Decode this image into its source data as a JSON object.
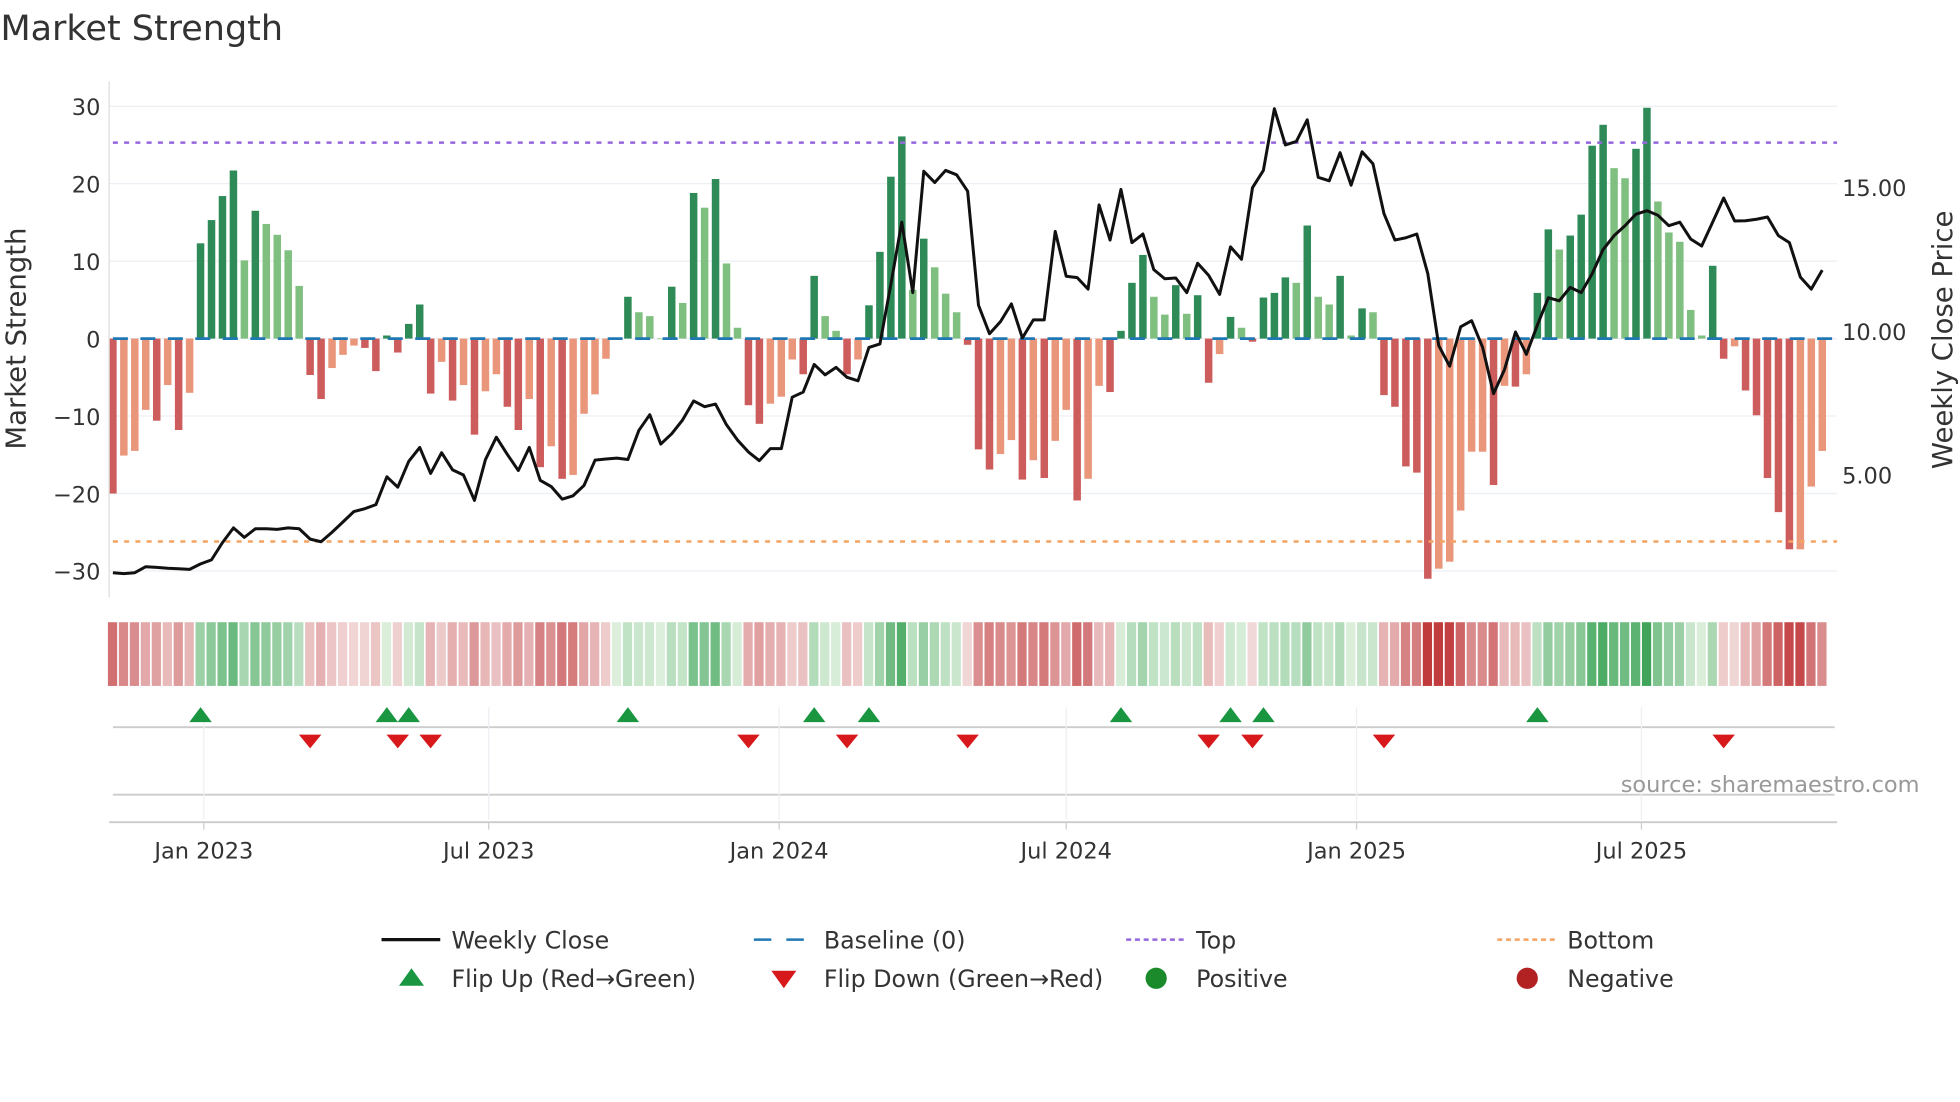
{
  "title": "Market Strength",
  "source": "source: sharemaestro.com",
  "chart_data": {
    "type": "bar+line",
    "title": "Market Strength",
    "ylabel_left": "Market Strength",
    "ylabel_right": "Weekly Close Price",
    "ylim_left": [
      -33,
      33
    ],
    "yticks_left": [
      "30",
      "20",
      "10",
      "0",
      "−10",
      "−20",
      "−30"
    ],
    "ytick_values_left": [
      30,
      20,
      10,
      0,
      -10,
      -20,
      -30
    ],
    "yticks_right": [
      "15.00",
      "10.00",
      "5.00"
    ],
    "ytick_values_right": [
      15,
      10,
      5
    ],
    "xticks": [
      "Jan 2023",
      "Jul 2023",
      "Jan 2024",
      "Jul 2024",
      "Jan 2025",
      "Jul 2025"
    ],
    "xtick_week_index": [
      8.3,
      34.3,
      60.8,
      87,
      113.5,
      139.5
    ],
    "top_level": 25.3,
    "bottom_level": -26.2,
    "baseline": 0,
    "strength": [
      -20,
      -15.1,
      -14.5,
      -9.2,
      -10.6,
      -6,
      -11.8,
      -7,
      12.3,
      15.3,
      18.4,
      21.7,
      10.1,
      16.5,
      14.8,
      13.4,
      11.4,
      6.8,
      -4.7,
      -7.8,
      -3.8,
      -2.1,
      -0.9,
      -1.2,
      -4.2,
      0.4,
      -1.8,
      1.9,
      4.4,
      -7.1,
      -3,
      -8,
      -6,
      -12.4,
      -6.8,
      -4.6,
      -8.8,
      -11.8,
      -7.8,
      -16.6,
      -13.9,
      -18.1,
      -17.6,
      -9.7,
      -7.2,
      -2.6,
      0,
      5.4,
      3.4,
      2.9,
      0,
      6.7,
      4.6,
      18.8,
      16.9,
      20.6,
      9.7,
      1.4,
      -8.6,
      -11,
      -8.4,
      -7.5,
      -2.7,
      -4.6,
      8.1,
      2.9,
      1,
      -4.6,
      -2.7,
      4.3,
      11.2,
      20.9,
      26.1,
      6.3,
      12.9,
      9.2,
      5.8,
      3.4,
      -0.8,
      -14.3,
      -16.9,
      -14.9,
      -13.1,
      -18.2,
      -15.7,
      -18,
      -13.2,
      -9.2,
      -20.9,
      -18.1,
      -6.1,
      -6.9,
      1,
      7.2,
      10.8,
      5.4,
      3.1,
      6.9,
      3.2,
      5.6,
      -5.7,
      -2,
      2.8,
      1.4,
      -0.4,
      5.3,
      5.9,
      7.9,
      7.2,
      14.6,
      5.4,
      4.4,
      8.1,
      0.4,
      3.9,
      3.4,
      -7.3,
      -8.8,
      -16.5,
      -17.3,
      -31,
      -29.7,
      -28.8,
      -22.2,
      -14.6,
      -14.6,
      -18.9,
      -6.1,
      -6.2,
      -4.6,
      5.9,
      14.1,
      11.5,
      13.3,
      16,
      24.9,
      27.6,
      22,
      20.7,
      24.5,
      29.8,
      17.7,
      13.7,
      12.5,
      3.7,
      0.4,
      9.4,
      -2.6,
      -1,
      -6.7,
      -9.9,
      -18,
      -22.4,
      -27.2,
      -27.2,
      -19.1,
      -14.5
    ],
    "weekly_close": [
      1.59,
      1.56,
      1.59,
      1.8,
      1.78,
      1.75,
      1.73,
      1.71,
      1.9,
      2.04,
      2.64,
      3.15,
      2.82,
      3.12,
      3.12,
      3.1,
      3.15,
      3.12,
      2.76,
      2.67,
      3,
      3.36,
      3.72,
      3.82,
      3.96,
      4.93,
      4.57,
      5.47,
      5.95,
      5.05,
      5.77,
      5.17,
      4.99,
      4.11,
      5.53,
      6.31,
      5.71,
      5.15,
      5.95,
      4.81,
      4.59,
      4.15,
      4.27,
      4.63,
      5.51,
      5.55,
      5.58,
      5.53,
      6.55,
      7.09,
      6.07,
      6.43,
      6.91,
      7.57,
      7.37,
      7.46,
      6.74,
      6.21,
      5.79,
      5.49,
      5.91,
      5.91,
      7.7,
      7.88,
      8.84,
      8.48,
      8.74,
      8.39,
      8.27,
      9.43,
      9.55,
      11.64,
      13.79,
      11.34,
      15.56,
      15.17,
      15.59,
      15.44,
      14.87,
      10.9,
      9.91,
      10.33,
      10.95,
      9.76,
      10.39,
      10.39,
      13.47,
      11.91,
      11.86,
      11.46,
      14.39,
      13.17,
      14.93,
      13.08,
      13.38,
      12.14,
      11.82,
      11.85,
      11.34,
      12.36,
      11.94,
      11.28,
      12.93,
      12.5,
      14.99,
      15.59,
      17.74,
      16.48,
      16.6,
      17.35,
      15.35,
      15.23,
      16.21,
      15.08,
      16.24,
      15.82,
      14.09,
      13.17,
      13.25,
      13.38,
      12,
      9.49,
      8.78,
      10.15,
      10.36,
      9.43,
      7.82,
      8.66,
      9.97,
      9.19,
      10.21,
      11.16,
      11.05,
      11.52,
      11.34,
      12,
      12.84,
      13.32,
      13.67,
      14.07,
      14.19,
      14.03,
      13.67,
      13.79,
      13.2,
      12.96,
      13.79,
      14.63,
      13.83,
      13.84,
      13.89,
      13.97,
      13.32,
      13.08,
      11.88,
      11.46,
      12.12
    ],
    "legend_position": "bottom",
    "legend": [
      {
        "label": "Weekly Close",
        "symbol": "line"
      },
      {
        "label": "Baseline (0)",
        "symbol": "dashed"
      },
      {
        "label": "Top",
        "symbol": "dotted"
      },
      {
        "label": "Bottom",
        "symbol": "dotted"
      },
      {
        "label": "Flip Up (Red→Green)",
        "symbol": "triangle-up"
      },
      {
        "label": "Flip Down (Green→Red)",
        "symbol": "triangle-down"
      },
      {
        "label": "Positive",
        "symbol": "circle"
      },
      {
        "label": "Negative",
        "symbol": "circle"
      }
    ],
    "colors": {
      "pos_rising": "#2e8b57",
      "pos_falling": "#7fbf7f",
      "neg_falling": "#cd5c5c",
      "neg_rising": "#e9967a",
      "price": "#111111",
      "baseline": "#1f77b4",
      "top": "#9467dd",
      "bottom": "#f4a460",
      "flip_up": "#1a9641",
      "flip_down": "#d7191c",
      "positive": "#1a8a2a",
      "negative": "#b22222"
    }
  }
}
